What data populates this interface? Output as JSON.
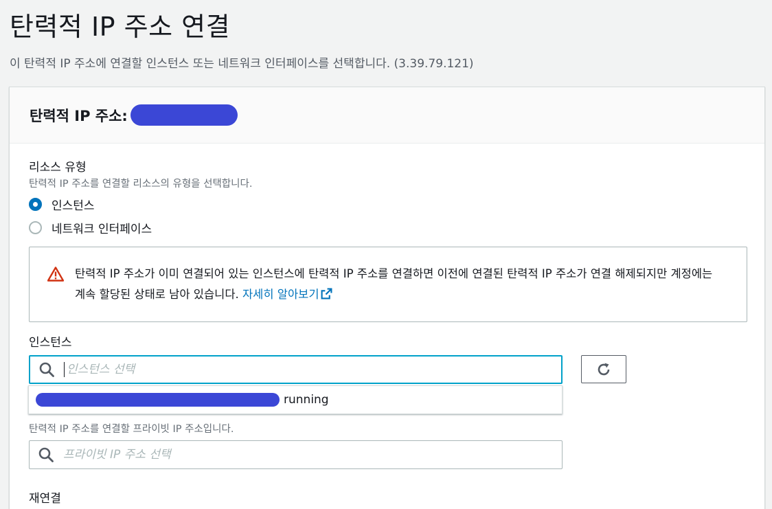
{
  "page": {
    "title": "탄력적 IP 주소 연결",
    "description": "이 탄력적 IP 주소에 연결할 인스턴스 또는 네트워크 인터페이스를 선택합니다. (3.39.79.121)"
  },
  "panel": {
    "header_title": "탄력적 IP 주소:"
  },
  "resource_type": {
    "label": "리소스 유형",
    "description": "탄력적 IP 주소를 연결할 리소스의 유형을 선택합니다.",
    "options": [
      {
        "label": "인스턴스",
        "selected": true
      },
      {
        "label": "네트워크 인터페이스",
        "selected": false
      }
    ]
  },
  "alert": {
    "icon": "warning-icon",
    "text": "탄력적 IP 주소가 이미 연결되어 있는 인스턴스에 탄력적 IP 주소를 연결하면 이전에 연결된 탄력적 IP 주소가 연결 해제되지만 계정에는 계속 할당된 상태로 남아 있습니다. ",
    "link_text": "자세히 알아보기"
  },
  "instance": {
    "label": "인스턴스",
    "placeholder": "인스턴스 선택",
    "dropdown_status": "running"
  },
  "private_ip": {
    "description": "탄력적 IP 주소를 연결할 프라이빗 IP 주소입니다.",
    "placeholder": "프라이빗 IP 주소 선택"
  },
  "reassociation": {
    "label": "재연결"
  },
  "colors": {
    "accent": "#0073bb",
    "focus": "#00a1c9",
    "warning": "#d13212",
    "redaction": "#3b47d6"
  }
}
